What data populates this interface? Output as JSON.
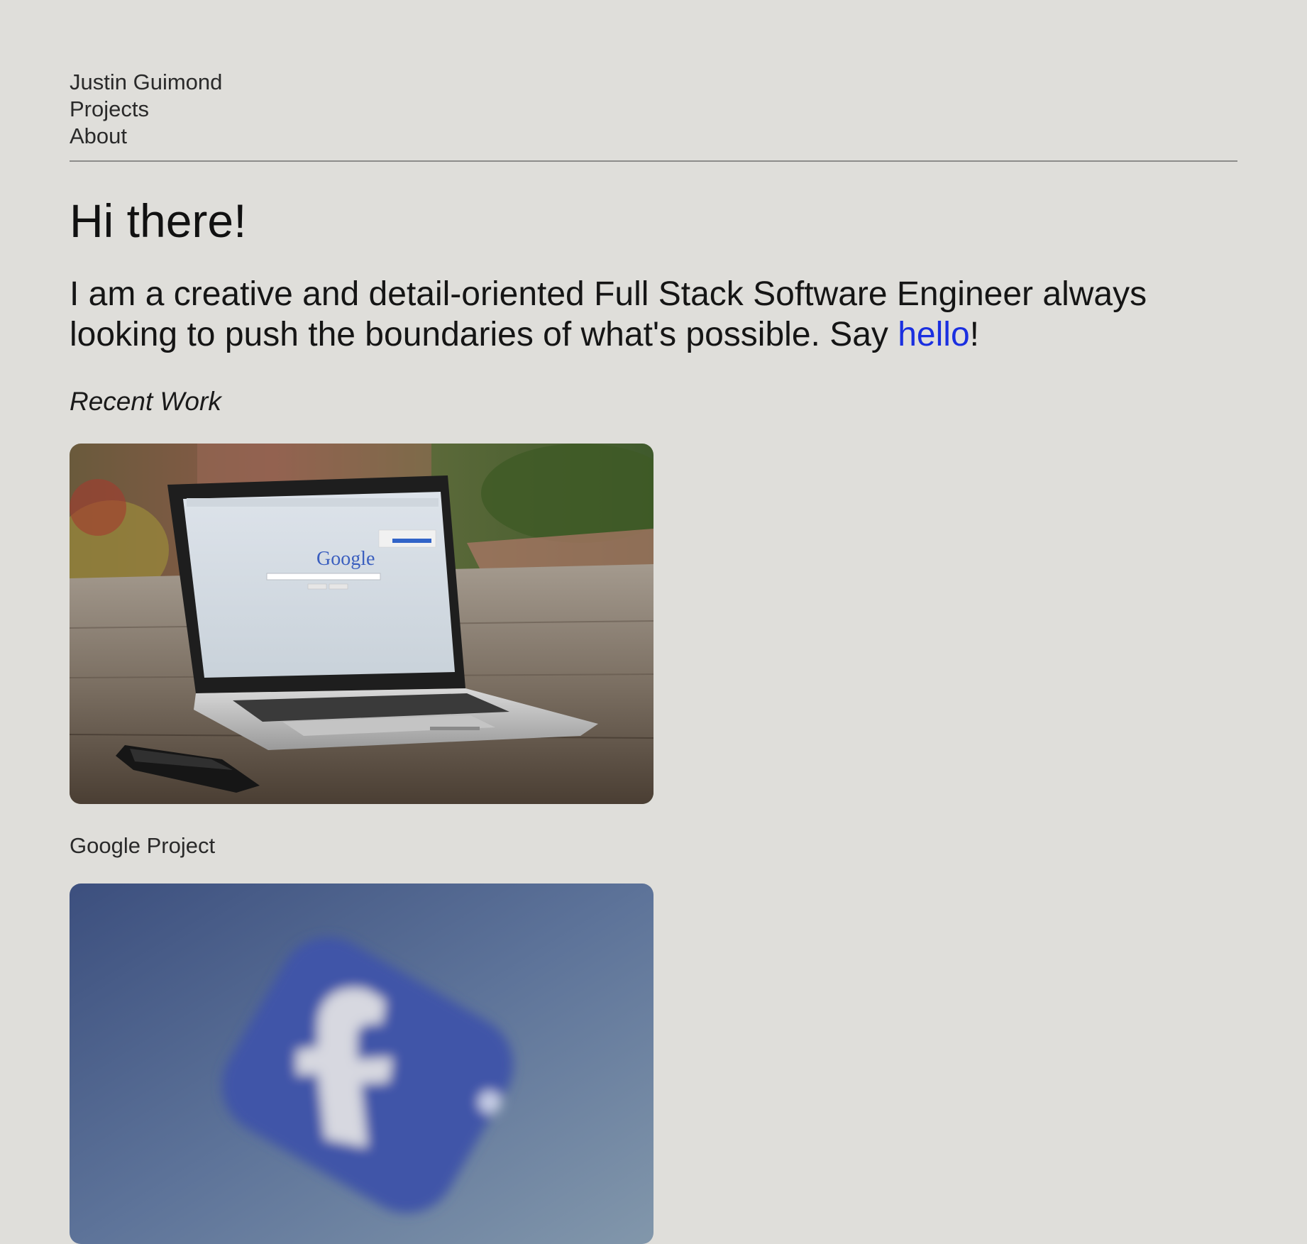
{
  "nav": {
    "name": "Justin Guimond",
    "projects": "Projects",
    "about": "About"
  },
  "hero": {
    "greeting": "Hi there!",
    "intro_text": "I am a creative and detail-oriented Full Stack Software Engineer always looking to push the boundaries of what's possible. Say ",
    "hello_link": "hello",
    "intro_end": "!"
  },
  "recent_work": {
    "heading": "Recent Work",
    "projects": [
      {
        "title": "Google Project",
        "image": "laptop-google-photo"
      },
      {
        "title": "",
        "image": "facebook-logo-photo"
      }
    ]
  },
  "colors": {
    "background": "#dfdeda",
    "link": "#1a2fe0",
    "divider": "#8c8c8a"
  }
}
